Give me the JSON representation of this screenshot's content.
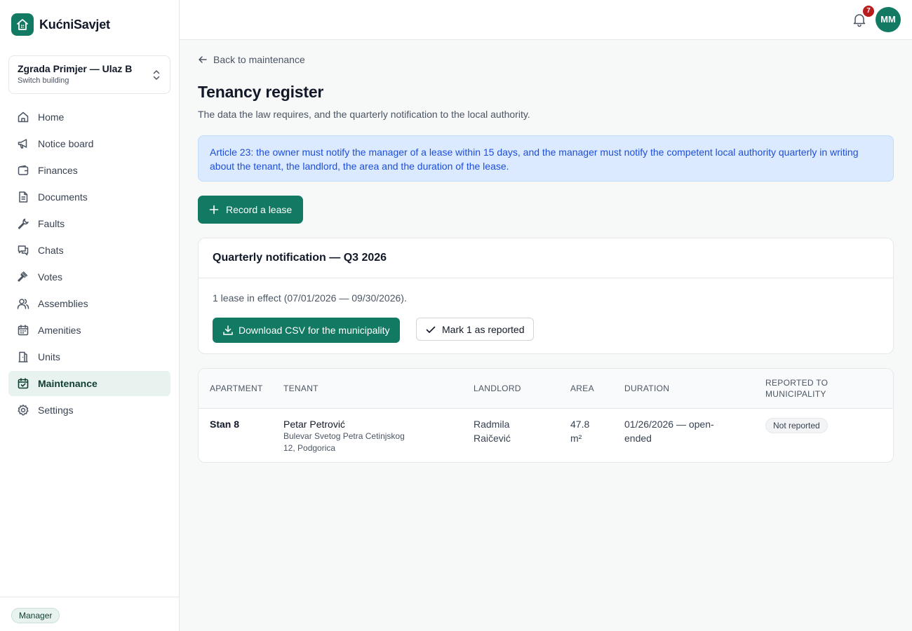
{
  "app": {
    "name": "KućniSavjet"
  },
  "building": {
    "name": "Zgrada Primjer — Ulaz B",
    "sub": "Switch building"
  },
  "nav": [
    {
      "label": "Home",
      "icon": "home-icon"
    },
    {
      "label": "Notice board",
      "icon": "megaphone-icon"
    },
    {
      "label": "Finances",
      "icon": "wallet-icon"
    },
    {
      "label": "Documents",
      "icon": "document-icon"
    },
    {
      "label": "Faults",
      "icon": "wrench-icon"
    },
    {
      "label": "Chats",
      "icon": "chat-icon"
    },
    {
      "label": "Votes",
      "icon": "gavel-icon"
    },
    {
      "label": "Assemblies",
      "icon": "users-icon"
    },
    {
      "label": "Amenities",
      "icon": "calendar-icon"
    },
    {
      "label": "Units",
      "icon": "door-icon"
    },
    {
      "label": "Maintenance",
      "icon": "calendar-check-icon",
      "active": true
    },
    {
      "label": "Settings",
      "icon": "gear-icon"
    }
  ],
  "role": "Manager",
  "topbar": {
    "notifications": "7",
    "avatar": "MM"
  },
  "page": {
    "back": "Back to maintenance",
    "title": "Tenancy register",
    "subtitle": "The data the law requires, and the quarterly notification to the local authority.",
    "info": "Article 23: the owner must notify the manager of a lease within 15 days, and the manager must notify the competent local authority quarterly in writing about the tenant, the landlord, the area and the duration of the lease.",
    "record_button": "Record a lease"
  },
  "quarter": {
    "title": "Quarterly notification — Q3 2026",
    "text": "1 lease in effect (07/01/2026 — 09/30/2026).",
    "download_button": "Download CSV for the municipality",
    "mark_button": "Mark 1 as reported"
  },
  "table": {
    "headers": {
      "apartment": "APARTMENT",
      "tenant": "TENANT",
      "landlord": "LANDLORD",
      "area": "AREA",
      "duration": "DURATION",
      "reported_1": "REPORTED TO",
      "reported_2": "MUNICIPALITY"
    },
    "rows": [
      {
        "apartment": "Stan 8",
        "tenant": "Petar Petrović",
        "tenant_address_1": "Bulevar Svetog Petra Cetinjskog",
        "tenant_address_2": "12, Podgorica",
        "landlord_1": "Radmila",
        "landlord_2": "Raičević",
        "area_1": "47.8",
        "area_2": "m²",
        "duration_1": "01/26/2026 — open-",
        "duration_2": "ended",
        "status": "Not reported"
      }
    ]
  }
}
